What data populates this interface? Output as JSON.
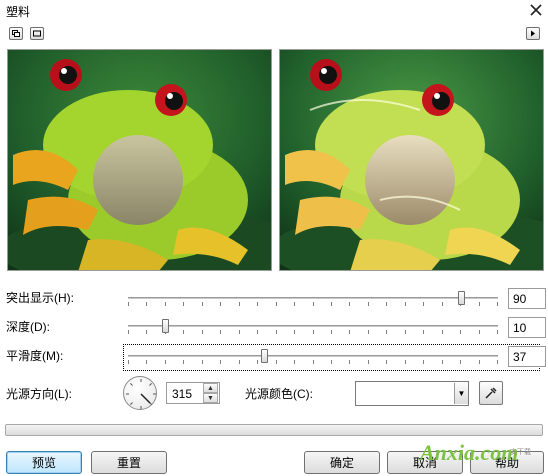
{
  "window": {
    "title": "塑料",
    "close_icon": "close-icon"
  },
  "toolbar": {
    "left_buttons": [
      "dual-preview-icon",
      "single-preview-icon"
    ],
    "right_button": "expand-arrow-icon"
  },
  "sliders": [
    {
      "label": "突出显示(H):",
      "value": "90",
      "level_percent": 90
    },
    {
      "label": "深度(D):",
      "value": "10",
      "level_percent": 10
    },
    {
      "label": "平滑度(M):",
      "value": "37",
      "level_percent": 37
    }
  ],
  "light_direction": {
    "label": "光源方向(L):",
    "value": "315"
  },
  "light_color": {
    "label": "光源颜色(C):",
    "value": "",
    "eyedropper_icon": "eyedropper-icon"
  },
  "buttons": {
    "preview": "预览",
    "reset": "重置",
    "ok": "确定",
    "cancel": "取消",
    "help": "帮助"
  },
  "watermark": {
    "text": "Anxia.com",
    "subtext": "安下载"
  },
  "colors": {
    "accent": "#3c7fb1",
    "frog_green": "#9acb2a",
    "background_green": "#1e5a2c"
  }
}
